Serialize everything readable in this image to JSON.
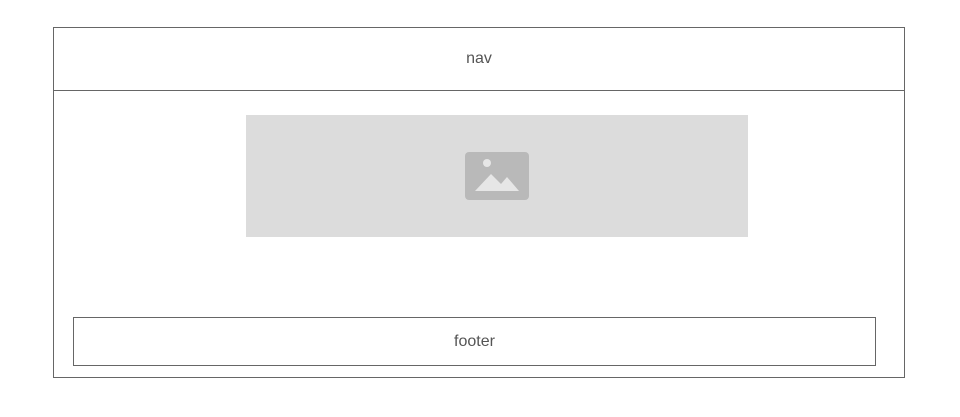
{
  "nav": {
    "label": "nav"
  },
  "hero": {
    "icon": "image-placeholder-icon"
  },
  "footer": {
    "label": "footer"
  },
  "colors": {
    "border": "#666666",
    "placeholder_bg": "#dcdcdc",
    "placeholder_icon": "#b9b9b9",
    "text": "#555555"
  }
}
